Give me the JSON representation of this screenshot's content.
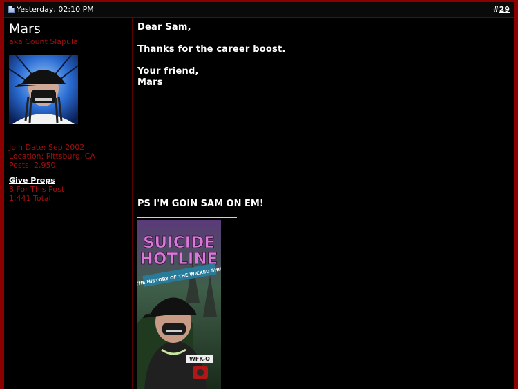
{
  "header": {
    "date": "Yesterday, 02:10 PM",
    "post_prefix": "#",
    "post_number": "29"
  },
  "user": {
    "name": "Mars",
    "title": "aka Count Slapula",
    "join_date": "Join Date: Sep 2002",
    "location": "Location: Pittsburg, CA",
    "posts": "Posts: 2,950",
    "give_props": "Give Props",
    "props_post": "8 For This Post",
    "props_total": "1,441 Total"
  },
  "message": {
    "greeting": "Dear Sam,",
    "body": "Thanks for the career boost.",
    "closing": "Your friend,",
    "signoff": "Mars",
    "ps": "PS I'M GOIN SAM ON EM!"
  },
  "signature_banner": {
    "title_line1": "SUICIDE",
    "title_line2": "HOTLINE",
    "subtitle": "THE HISTORY OF THE WICKED SHIT",
    "badge": "WFK-O"
  },
  "colors": {
    "frame": "#8b0000",
    "user_info_text": "#a01010",
    "message_text": "#ffffff"
  }
}
